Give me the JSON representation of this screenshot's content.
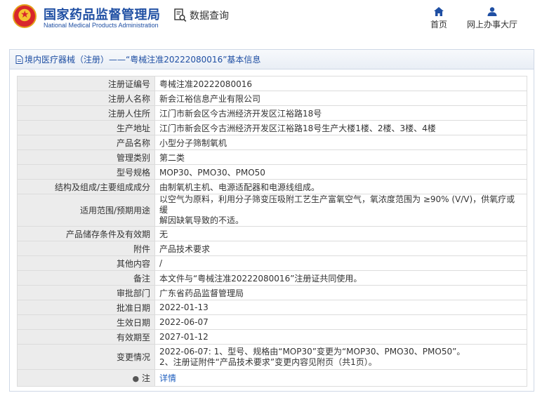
{
  "header": {
    "brand_cn": "国家药品监督管理局",
    "brand_en": "National Medical Products Administration",
    "query_label": "数据查询",
    "nav": [
      {
        "label": "首页",
        "icon": "home-icon"
      },
      {
        "label": "网上办事大厅",
        "icon": "user-icon"
      }
    ]
  },
  "panel": {
    "title": "境内医疗器械（注册）——“粤械注准20222080016”基本信息"
  },
  "rows": [
    {
      "label": "注册证编号",
      "value": "粤械注准20222080016"
    },
    {
      "label": "注册人名称",
      "value": "新会江裕信息产业有限公司"
    },
    {
      "label": "注册人住所",
      "value": "江门市新会区今古洲经济开发区江裕路18号"
    },
    {
      "label": "生产地址",
      "value": "江门市新会区今古洲经济开发区江裕路18号生产大楼1楼、2楼、3楼、4楼"
    },
    {
      "label": "产品名称",
      "value": "小型分子筛制氧机"
    },
    {
      "label": "管理类别",
      "value": "第二类"
    },
    {
      "label": "型号规格",
      "value": "MOP30、PMO30、PMO50"
    },
    {
      "label": "结构及组成/主要组成成分",
      "value": "由制氧机主机、电源适配器和电源线组成。"
    },
    {
      "label": "适用范围/预期用途",
      "value_lines": [
        "以空气为原料，利用分子筛变压吸附工艺生产富氧空气，氧浓度范围为 ≥90% (V/V)，供氧疗或缓",
        "解因缺氧导致的不适。"
      ]
    },
    {
      "label": "产品储存条件及有效期",
      "value": "无"
    },
    {
      "label": "附件",
      "value": "产品技术要求"
    },
    {
      "label": "其他内容",
      "value": "/"
    },
    {
      "label": "备注",
      "value": "本文件与“粤械注准20222080016”注册证共同使用。"
    },
    {
      "label": "审批部门",
      "value": "广东省药品监督管理局"
    },
    {
      "label": "批准日期",
      "value": "2022-01-13"
    },
    {
      "label": "生效日期",
      "value": "2022-06-07"
    },
    {
      "label": "有效期至",
      "value": "2027-01-12"
    },
    {
      "label": "变更情况",
      "value_lines": [
        "2022-06-07: 1、型号、规格由“MOP30”变更为“MOP30、PMO30、PMO50”。",
        "2、注册证附件“产品技术要求”变更内容见附页（共1页）。"
      ]
    },
    {
      "label": "注",
      "value": "详情",
      "pin_icon": "pin-icon"
    }
  ],
  "colors": {
    "brand": "#1f4fa3",
    "label_bg": "#ececec",
    "link": "#1f5fbf"
  }
}
